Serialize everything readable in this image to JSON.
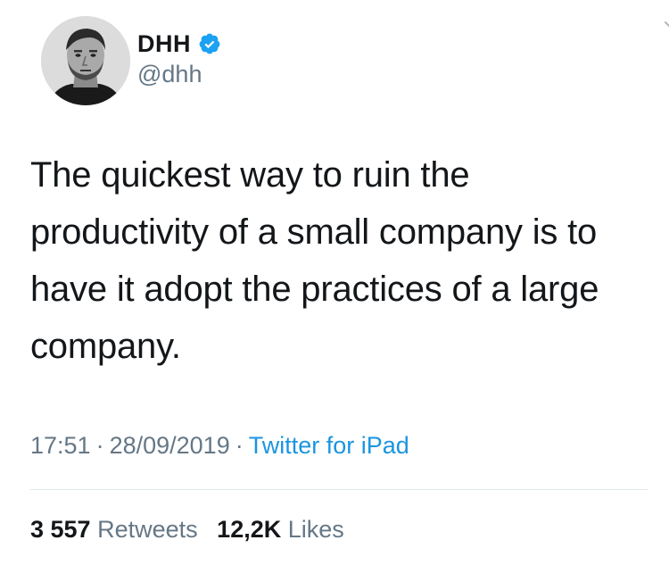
{
  "author": {
    "display_name": "DHH",
    "handle": "@dhh",
    "verified": true,
    "avatar_icon": "profile-photo"
  },
  "tweet": {
    "text": "The quickest way to ruin the productivity of a small company is to have it adopt the practices of a large company."
  },
  "meta": {
    "time": "17:51",
    "date": "28/09/2019",
    "source": "Twitter for iPad",
    "separator": "·"
  },
  "stats": {
    "retweets_count": "3 557",
    "retweets_label": "Retweets",
    "likes_count": "12,2K",
    "likes_label": "Likes"
  },
  "colors": {
    "text": "#14171a",
    "secondary": "#657786",
    "link": "#1b95e0",
    "verified": "#1da1f2",
    "divider": "#e1e8ed"
  }
}
